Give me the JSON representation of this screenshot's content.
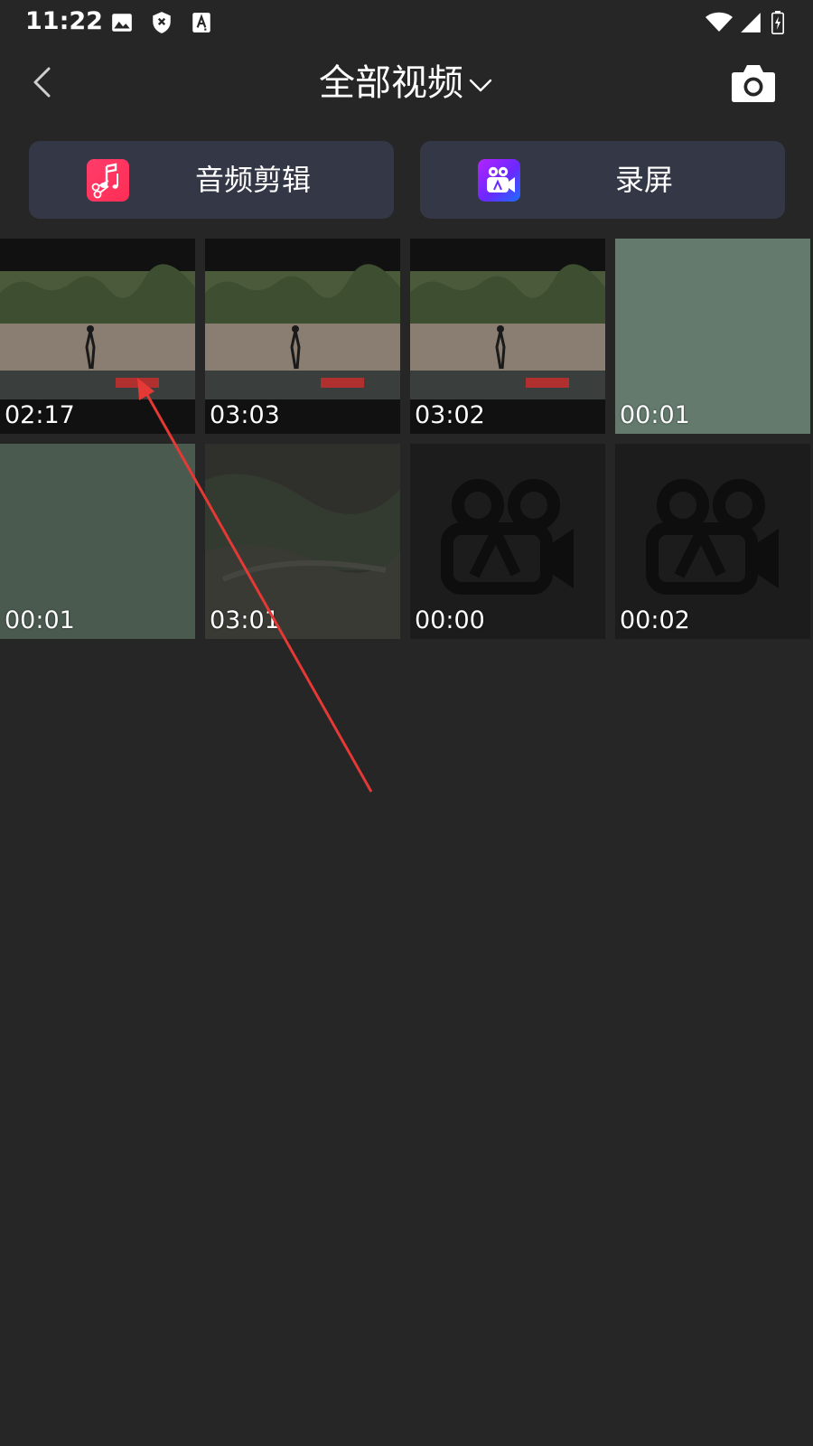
{
  "status_bar": {
    "time": "11:22",
    "icons": [
      "image-icon",
      "shield-x-icon",
      "font-a-icon",
      "wifi-icon",
      "cell-signal-icon",
      "battery-charging-icon"
    ]
  },
  "header": {
    "title": "全部视频",
    "back_icon": "chevron-left-icon",
    "dropdown_icon": "chevron-down-icon",
    "camera_icon": "camera-icon"
  },
  "quick_actions": [
    {
      "label": "音频剪辑",
      "icon": "music-scissors-icon",
      "accent": "#ff3366"
    },
    {
      "label": "录屏",
      "icon": "video-camera-icon",
      "accent": "#8a2bff"
    }
  ],
  "videos": [
    {
      "duration": "02:17",
      "thumb": "concert-scene"
    },
    {
      "duration": "03:03",
      "thumb": "concert-scene"
    },
    {
      "duration": "03:02",
      "thumb": "concert-scene"
    },
    {
      "duration": "00:01",
      "thumb": "solid-green"
    },
    {
      "duration": "00:01",
      "thumb": "solid-dark-green"
    },
    {
      "duration": "03:01",
      "thumb": "dark-landscape"
    },
    {
      "duration": "00:00",
      "thumb": "placeholder"
    },
    {
      "duration": "00:02",
      "thumb": "placeholder"
    }
  ],
  "colors": {
    "background": "#262626",
    "card": "#343745",
    "annotation": "#e53935"
  }
}
